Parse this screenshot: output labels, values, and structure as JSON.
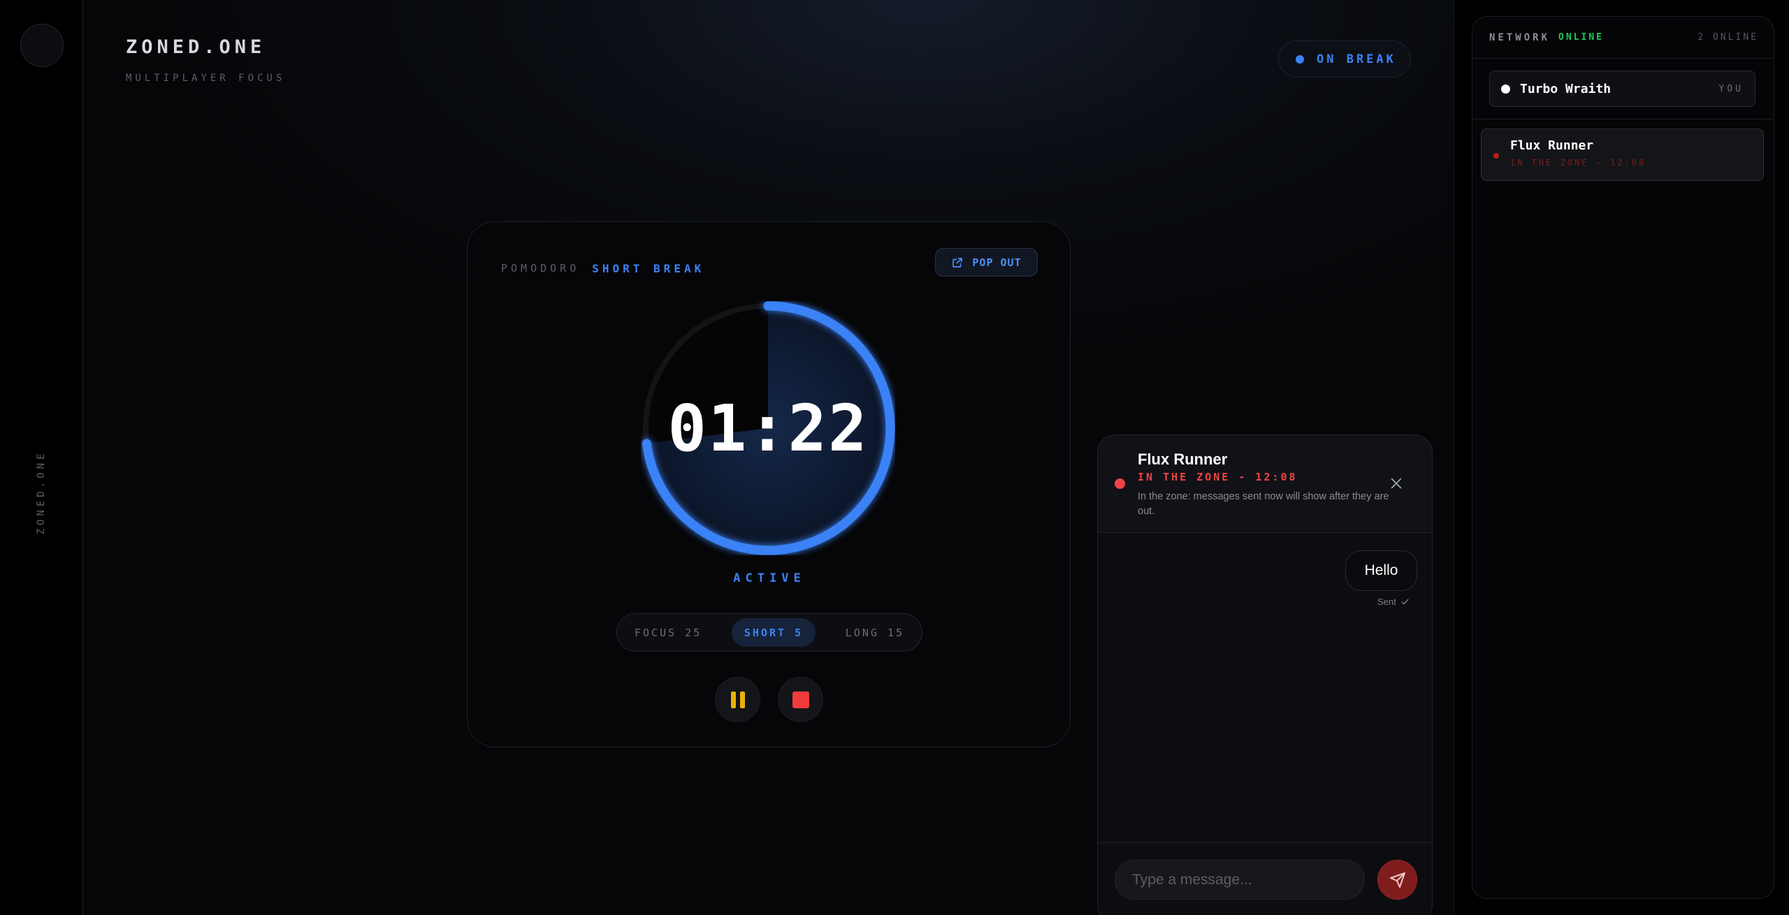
{
  "rail": {
    "brand_vertical": "ZONED.ONE"
  },
  "header": {
    "title": "ZONED.ONE",
    "subtitle": "MULTIPLAYER FOCUS",
    "status": "ON BREAK"
  },
  "timer": {
    "mode_kind": "POMODORO",
    "mode_name": "SHORT BREAK",
    "popout_label": "POP OUT",
    "time": "01:22",
    "progress_fraction": 0.73,
    "state": "ACTIVE",
    "presets": [
      {
        "label": "FOCUS 25",
        "active": false
      },
      {
        "label": "SHORT 5",
        "active": true
      },
      {
        "label": "LONG 15",
        "active": false
      }
    ]
  },
  "chat": {
    "peer_name": "Flux Runner",
    "peer_status": "IN THE ZONE - 12:08",
    "note": "In the zone: messages sent now will show after they are out.",
    "messages": [
      {
        "text": "Hello",
        "status": "Sent"
      }
    ],
    "input_placeholder": "Type a message..."
  },
  "network": {
    "title": "NETWORK",
    "state": "ONLINE",
    "count": "2 ONLINE",
    "self": {
      "name": "Turbo Wraith",
      "tag": "YOU"
    },
    "peers": [
      {
        "name": "Flux Runner",
        "status": "IN THE ZONE - 12:08"
      }
    ]
  },
  "colors": {
    "accent": "#3b82f6",
    "zone_red": "#ef4444",
    "online_green": "#22c55e",
    "pause_yellow": "#eab308"
  },
  "icons": {
    "popout": "external-link-icon",
    "close": "close-icon",
    "sent": "check-icon",
    "send": "send-icon",
    "pause": "pause-icon",
    "stop": "stop-icon"
  }
}
